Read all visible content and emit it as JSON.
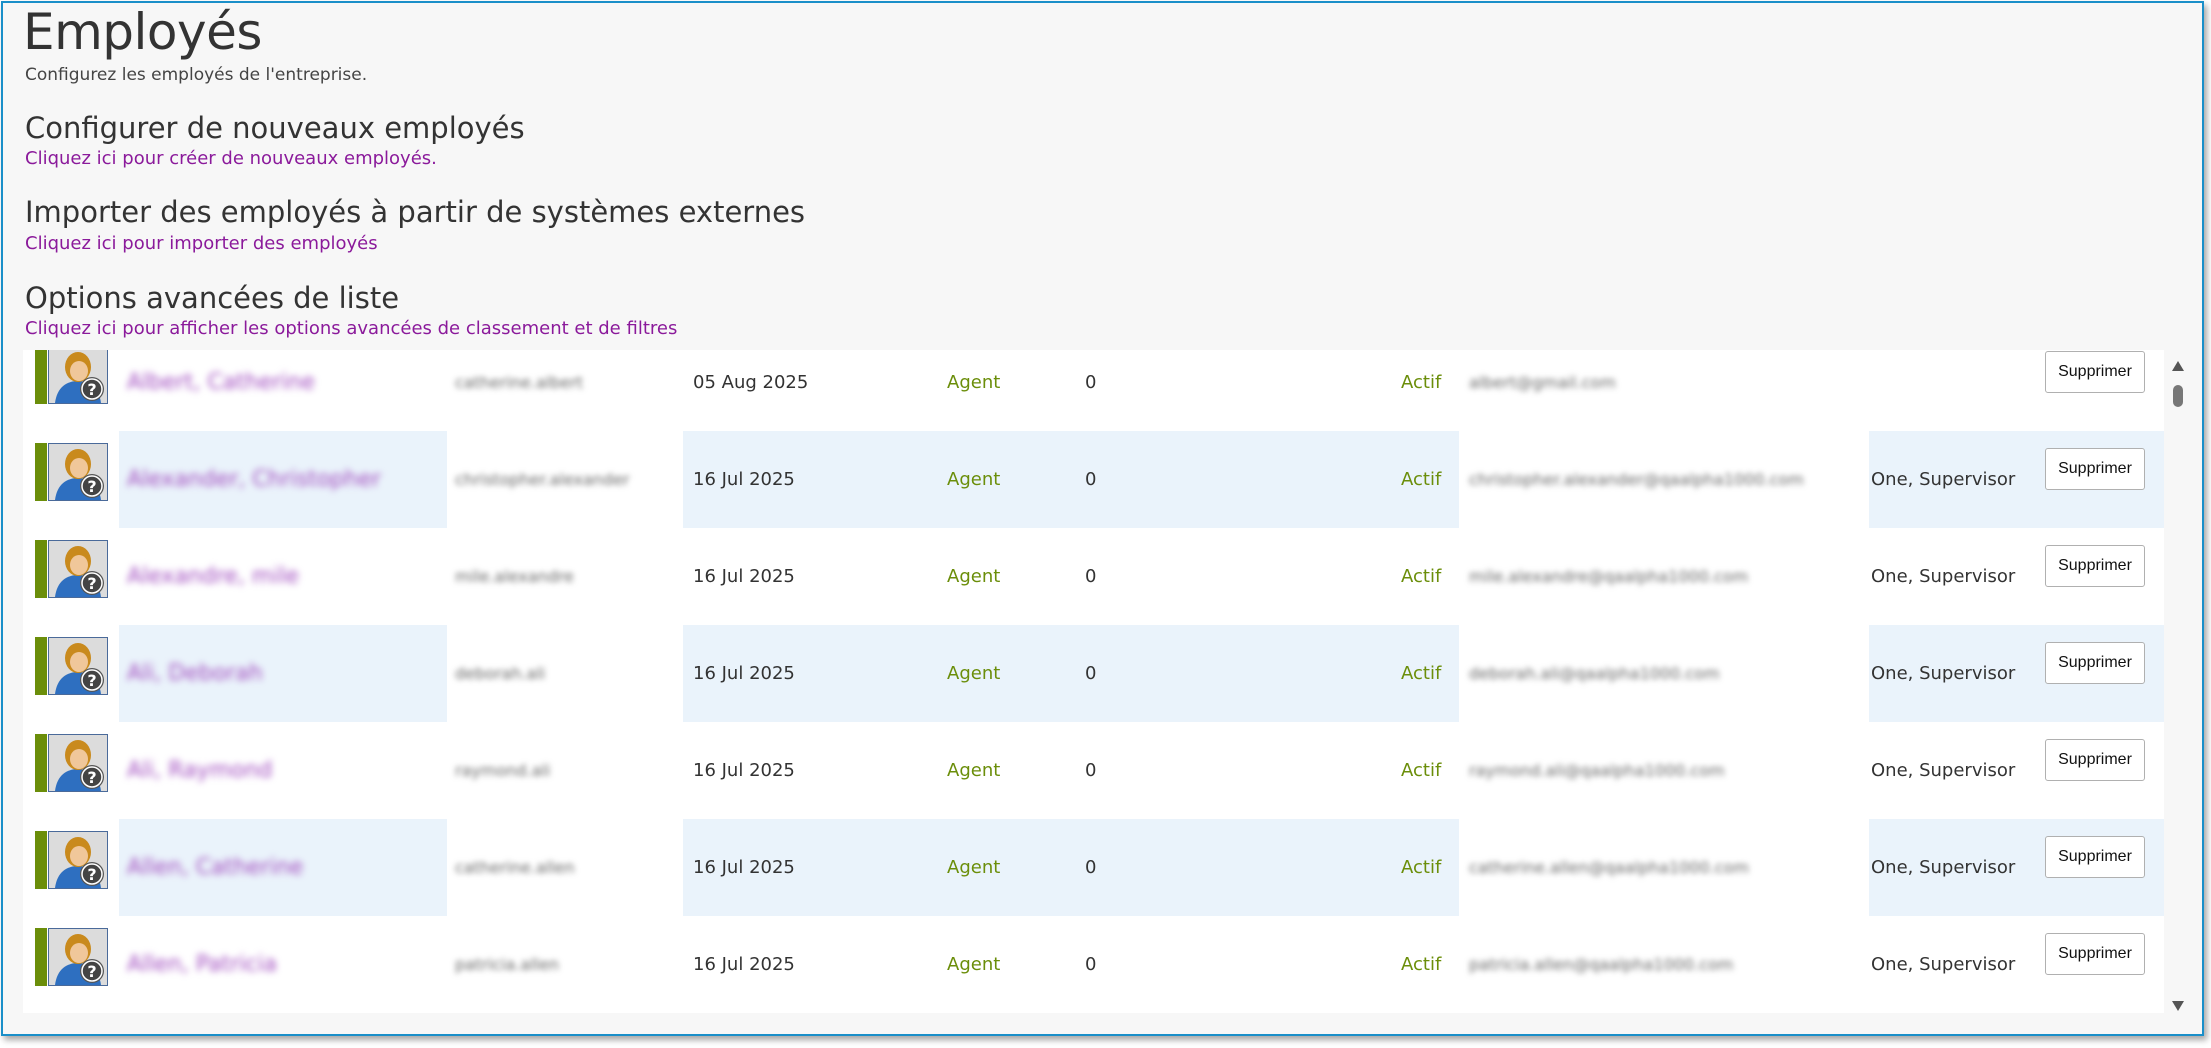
{
  "header": {
    "title": "Employés",
    "subtitle": "Configurez les employés de l'entreprise."
  },
  "sections": [
    {
      "heading": "Configurer de nouveaux employés",
      "link": "Cliquez ici pour créer de nouveaux employés."
    },
    {
      "heading": "Importer des employés à partir de systèmes externes",
      "link": "Cliquez ici pour importer des employés"
    },
    {
      "heading": "Options avancées de liste",
      "link": "Cliquez ici pour afficher les options avancées de classement et de filtres"
    }
  ],
  "employees": [
    {
      "name": "Albert, Catherine",
      "login": "catherine.albert",
      "date": "05 Aug 2025",
      "role": "Agent",
      "count": "0",
      "status": "Actif",
      "email": "albert@gmail.com",
      "supervisor": "",
      "delete_label": "Supprimer"
    },
    {
      "name": "Alexander, Christopher",
      "login": "christopher.alexander",
      "date": "16 Jul 2025",
      "role": "Agent",
      "count": "0",
      "status": "Actif",
      "email": "christopher.alexander@qaalpha1000.com",
      "supervisor": "One, Supervisor",
      "delete_label": "Supprimer"
    },
    {
      "name": "Alexandre, mile",
      "login": "mile.alexandre",
      "date": "16 Jul 2025",
      "role": "Agent",
      "count": "0",
      "status": "Actif",
      "email": "mile.alexandre@qaalpha1000.com",
      "supervisor": "One, Supervisor",
      "delete_label": "Supprimer"
    },
    {
      "name": "Ali, Deborah",
      "login": "deborah.ali",
      "date": "16 Jul 2025",
      "role": "Agent",
      "count": "0",
      "status": "Actif",
      "email": "deborah.ali@qaalpha1000.com",
      "supervisor": "One, Supervisor",
      "delete_label": "Supprimer"
    },
    {
      "name": "Ali, Raymond",
      "login": "raymond.ali",
      "date": "16 Jul 2025",
      "role": "Agent",
      "count": "0",
      "status": "Actif",
      "email": "raymond.ali@qaalpha1000.com",
      "supervisor": "One, Supervisor",
      "delete_label": "Supprimer"
    },
    {
      "name": "Allen, Catherine",
      "login": "catherine.allen",
      "date": "16 Jul 2025",
      "role": "Agent",
      "count": "0",
      "status": "Actif",
      "email": "catherine.allen@qaalpha1000.com",
      "supervisor": "One, Supervisor",
      "delete_label": "Supprimer"
    },
    {
      "name": "Allen, Patricia",
      "login": "patricia.allen",
      "date": "16 Jul 2025",
      "role": "Agent",
      "count": "0",
      "status": "Actif",
      "email": "patricia.allen@qaalpha1000.com",
      "supervisor": "One, Supervisor",
      "delete_label": "Supprimer"
    }
  ],
  "colors": {
    "link": "#8b1a9b",
    "active_green": "#6b8e0a",
    "alt_row": "#eaf3fb",
    "frame_border": "#1a8fc9"
  },
  "icons": {
    "avatar": "unknown-user-avatar-icon",
    "scroll_up": "scroll-up-arrow-icon",
    "scroll_down": "scroll-down-arrow-icon"
  }
}
